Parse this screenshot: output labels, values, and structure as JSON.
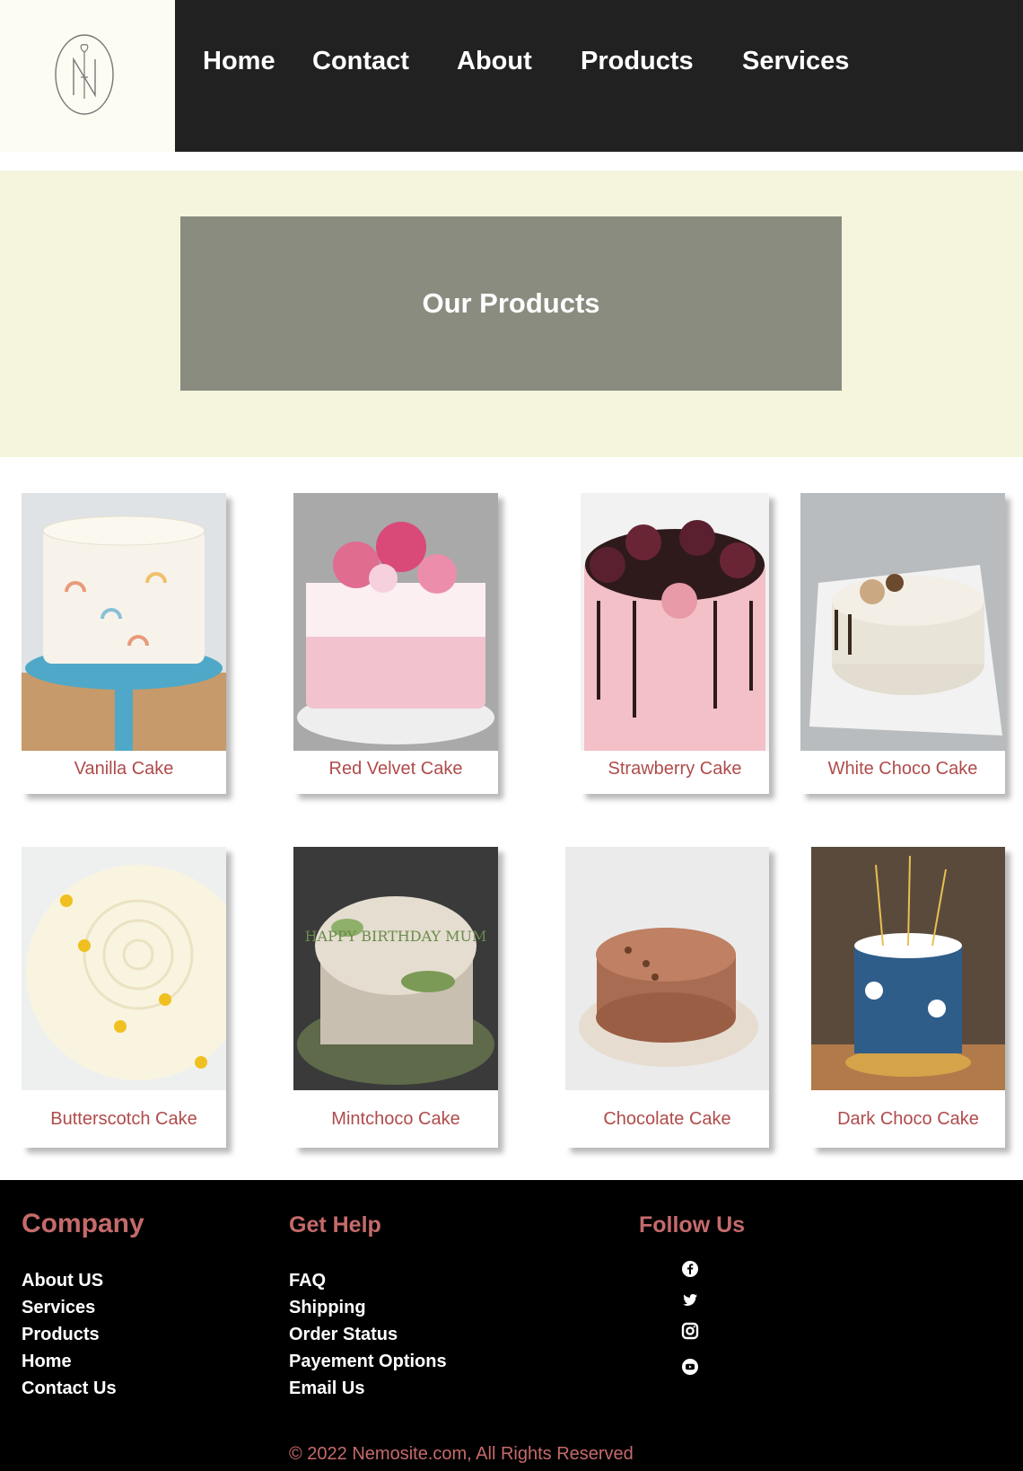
{
  "nav": {
    "home": "Home",
    "contact": "Contact",
    "about": "About",
    "products": "Products",
    "services": "Services"
  },
  "hero": {
    "title": "Our Products"
  },
  "products": [
    {
      "name": "Vanilla Cake"
    },
    {
      "name": "Red Velvet Cake"
    },
    {
      "name": "Strawberry Cake"
    },
    {
      "name": "White Choco Cake"
    },
    {
      "name": "Butterscotch Cake"
    },
    {
      "name": "Mintchoco Cake"
    },
    {
      "name": "Chocolate Cake"
    },
    {
      "name": "Dark Choco Cake"
    }
  ],
  "cake_text": "HAPPY BIRTHDAY MUM",
  "footer": {
    "company": {
      "heading": "Company",
      "links": [
        "About US",
        "Services",
        "Products",
        "Home",
        "Contact Us"
      ]
    },
    "help": {
      "heading": "Get Help",
      "links": [
        "FAQ",
        "Shipping",
        "Order Status",
        "Payement Options",
        "Email Us"
      ]
    },
    "follow": {
      "heading": "Follow Us",
      "icons": [
        "facebook-icon",
        "twitter-icon",
        "instagram-icon",
        "youtube-icon"
      ]
    },
    "copyright": "© 2022 Nemosite.com, All Rights Reserved"
  },
  "colors": {
    "nav_bg": "#212121",
    "hero_bg": "#f4f5dc",
    "hero_box": "#8a8c80",
    "accent": "#b04b4b",
    "footer_bg": "#000000"
  }
}
